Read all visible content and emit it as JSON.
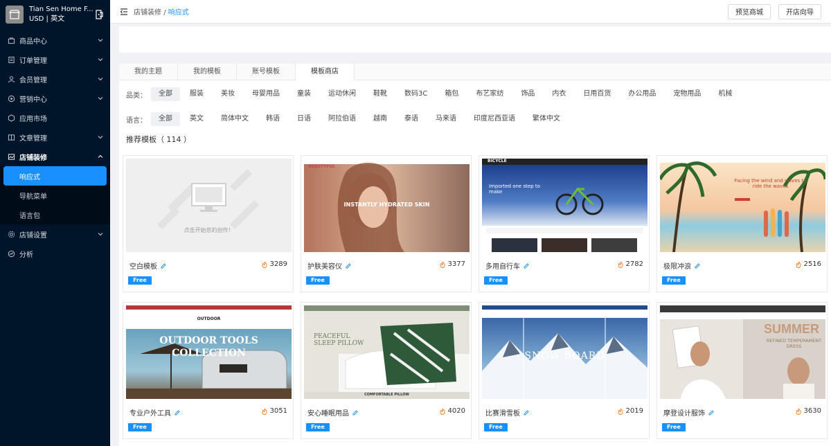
{
  "store": {
    "name": "Tian Sen Home F...",
    "sub": "USD | 英文"
  },
  "nav": {
    "items": [
      {
        "label": "商品中心"
      },
      {
        "label": "订单管理"
      },
      {
        "label": "会员管理"
      },
      {
        "label": "营销中心"
      },
      {
        "label": "应用市场"
      },
      {
        "label": "文章管理"
      },
      {
        "label": "店铺装修"
      }
    ],
    "sub_items": [
      {
        "label": "响应式"
      },
      {
        "label": "导航菜单"
      },
      {
        "label": "语言包"
      }
    ],
    "after": [
      {
        "label": "店铺设置"
      },
      {
        "label": "分析"
      }
    ]
  },
  "breadcrumb": {
    "parent": "店铺装修",
    "sep": "/",
    "current": "响应式"
  },
  "top_buttons": {
    "preview": "预览商城",
    "guide": "开店向导"
  },
  "tabs": [
    "我的主题",
    "我的模板",
    "账号模板",
    "模板商店"
  ],
  "filters": {
    "category_label": "品类：",
    "categories": [
      "全部",
      "服装",
      "美妆",
      "母婴用品",
      "童装",
      "运动休闲",
      "鞋靴",
      "数码3C",
      "箱包",
      "布艺家纺",
      "饰品",
      "内衣",
      "日用百货",
      "办公用品",
      "宠物用品",
      "机械"
    ],
    "language_label": "语言：",
    "languages": [
      "全部",
      "英文",
      "简体中文",
      "韩语",
      "日语",
      "阿拉伯语",
      "越南",
      "泰语",
      "马来语",
      "印度尼西亚语",
      "繁体中文"
    ]
  },
  "recommend": {
    "label": "推荐模板（",
    "count": "114",
    "close": "）"
  },
  "templates": [
    {
      "name": "空白模板",
      "hot": "3289",
      "badge": "Free",
      "hint": "点击开始您的创作！"
    },
    {
      "name": "护肤美容仪",
      "hot": "3377",
      "badge": "Free",
      "banner": "INSTANTLY HYDRATED SKIN",
      "brand": "BEAUTYFUL"
    },
    {
      "name": "多用自行车",
      "hot": "2782",
      "badge": "Free",
      "banner": "Imported one step to make",
      "brand": "BICYCLE"
    },
    {
      "name": "极限冲浪",
      "hot": "2516",
      "badge": "Free",
      "banner": "Facing the wind and waves to ride the waves"
    },
    {
      "name": "专业户外工具",
      "hot": "3051",
      "badge": "Free",
      "banner": "OUTDOOR TOOLS COLLECTION",
      "brand": "OUTDOOR"
    },
    {
      "name": "安心睡眠用品",
      "hot": "4020",
      "badge": "Free",
      "banner": "PEACEFUL SLEEP PILLOW",
      "caption": "COMFORTABLE PILLOW"
    },
    {
      "name": "比赛滑雪板",
      "hot": "2019",
      "badge": "Free",
      "banner": "SNOW BOARD"
    },
    {
      "name": "摩登设计服饰",
      "hot": "3630",
      "badge": "Free",
      "banner": "SUMMER",
      "banner2": "REFINED TEMPERAMENT DRESS"
    }
  ]
}
